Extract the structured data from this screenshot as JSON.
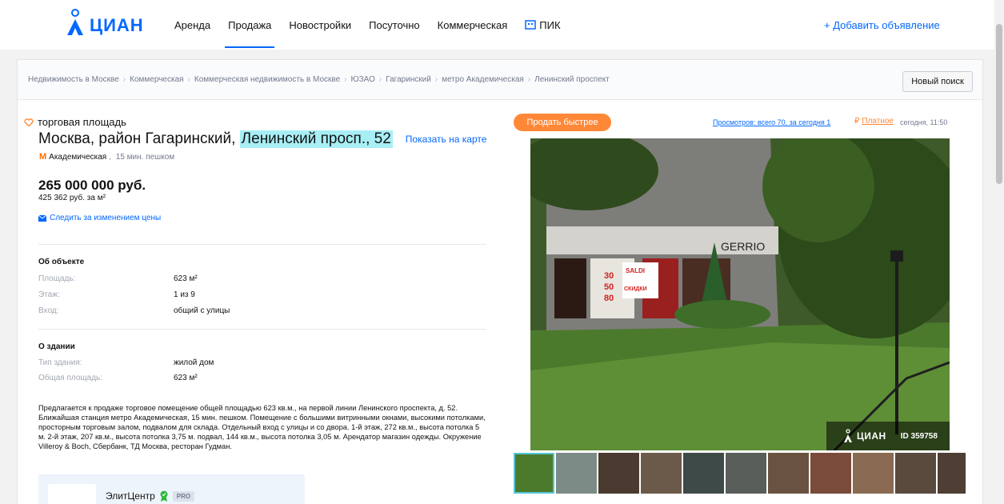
{
  "header": {
    "logo_text": "ЦИАН",
    "nav": [
      {
        "label": "Аренда",
        "active": false
      },
      {
        "label": "Продажа",
        "active": true
      },
      {
        "label": "Новостройки",
        "active": false
      },
      {
        "label": "Посуточно",
        "active": false
      },
      {
        "label": "Коммерческая",
        "active": false
      },
      {
        "label": "ПИК",
        "active": false
      }
    ],
    "add_listing": "+ Добавить объявление"
  },
  "breadcrumbs": [
    "Недвижимость в Москве",
    "Коммерческая",
    "Коммерческая недвижимость в Москве",
    "ЮЗАО",
    "Гагаринский",
    "метро Академическая",
    "Ленинский проспект"
  ],
  "new_search_label": "Новый поиск",
  "listing": {
    "type": "торговая площадь",
    "address_prefix": "Москва, район Гагаринский,",
    "address_highlight": "Ленинский просп., 52",
    "show_on_map": "Показать на карте",
    "metro_station": "Академическая",
    "metro_distance": "15 мин. пешком",
    "price": "265 000 000 руб.",
    "price_per_m2": "425 362 руб. за м²",
    "watch_price": "Следить за изменением цены"
  },
  "about_object": {
    "title": "Об объекте",
    "rows": [
      {
        "label": "Площадь:",
        "value": "623 м²"
      },
      {
        "label": "Этаж:",
        "value": "1 из 9"
      },
      {
        "label": "Вход:",
        "value": "общий с улицы"
      }
    ]
  },
  "about_building": {
    "title": "О здании",
    "rows": [
      {
        "label": "Тип здания:",
        "value": "жилой дом"
      },
      {
        "label": "Общая площадь:",
        "value": "623 м²"
      }
    ]
  },
  "description": "Предлагается к продаже торговое помещение общей площадью 623 кв.м., на первой линии Ленинского проспекта, д. 52. Ближайшая станция метро Академическая, 15 мин. пешком. Помещение с большими витринными окнами, высокими потолками, просторным торговым залом, подвалом для склада. Отдельный вход с улицы и со двора. 1-й этаж, 272 кв.м., высота потолка 5 м. 2-й этаж, 207 кв.м., высота потолка 3,75 м. подвал, 144 кв.м., высота потолка 3,05 м. Арендатор магазин одежды. Окружение Villeroy & Boch, Сбербанк, ТД Москва, ресторан Гудман.",
  "agent": {
    "name": "ЭлитЦентр",
    "badge": "PRO"
  },
  "sidebar": {
    "sell_fast": "Продать быстрее",
    "views": "Просмотров: всего 70, за сегодня 1",
    "paid_label": "Платное",
    "date": "сегодня, 11:50"
  },
  "photo": {
    "watermark_logo": "ЦИАН",
    "watermark_id": "ID 359758",
    "sign_text": "SALDI",
    "sign_sub": "СКИДКИ",
    "sale_nums": [
      "30",
      "50",
      "80"
    ],
    "store_text": "GERRIO",
    "thumbnail_count": 11
  },
  "colors": {
    "brand": "#0468ff",
    "accent_orange": "#ff8838",
    "highlight": "#a8eef5"
  }
}
